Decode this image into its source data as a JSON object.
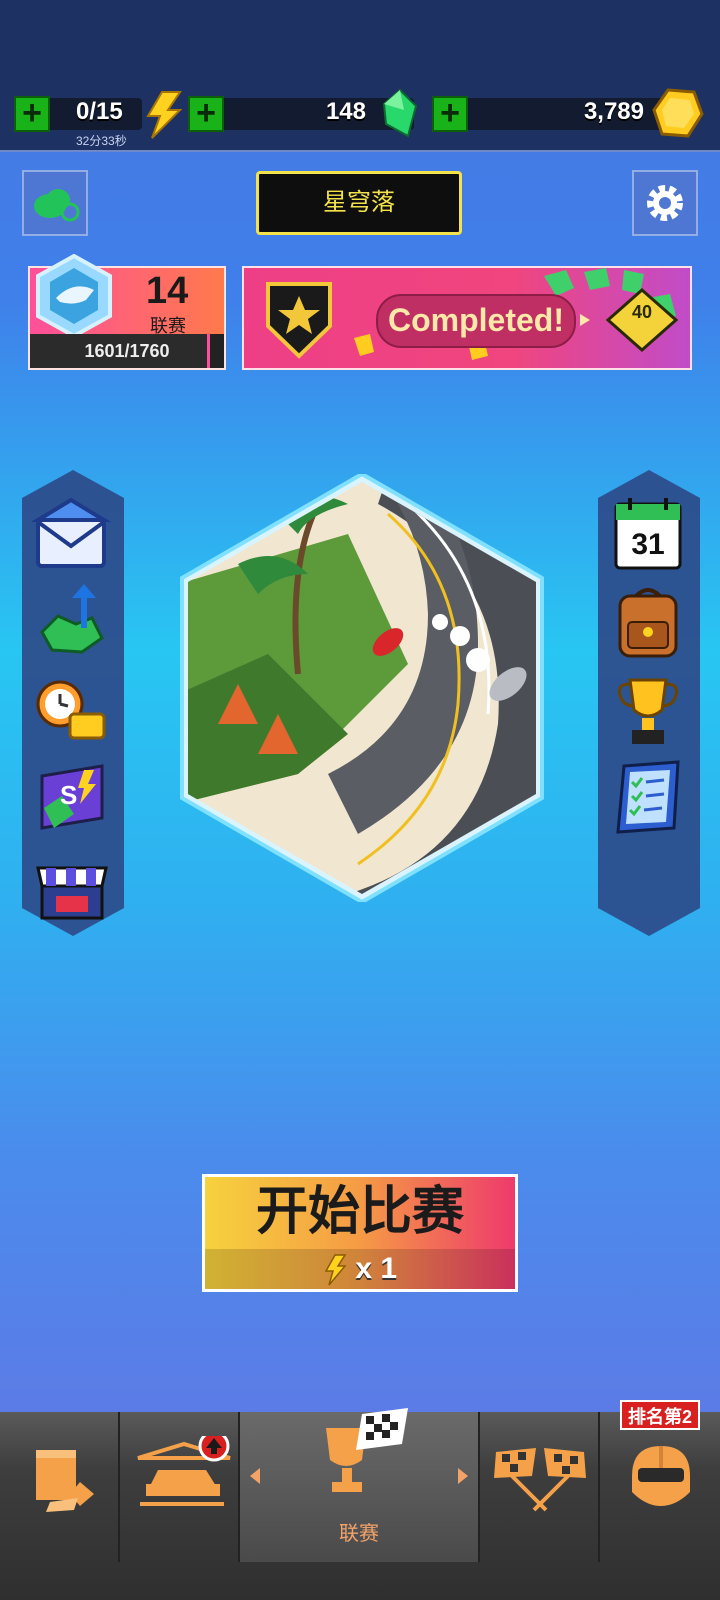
{
  "resources": {
    "energy": {
      "value": "0/15",
      "timer": "32分33秒"
    },
    "gems": {
      "value": "148"
    },
    "coins": {
      "value": "3,789"
    }
  },
  "header": {
    "player_name": "星穹落"
  },
  "league": {
    "number": "14",
    "label": "联赛",
    "progress": "1601/1760",
    "progress_fraction": 0.91
  },
  "quest": {
    "status": "Completed!",
    "reward": "40"
  },
  "left_menu": [
    "mail-icon",
    "gem-upgrade-icon",
    "timed-coins-icon",
    "season-pass-icon",
    "shop-icon"
  ],
  "right_menu": {
    "calendar_day": "31",
    "items": [
      "calendar-icon",
      "backpack-icon",
      "trophy-icon",
      "checklist-icon"
    ]
  },
  "start": {
    "title": "开始比赛",
    "cost": "x 1"
  },
  "nav": {
    "active_label": "联赛",
    "rank_badge": "排名第2"
  },
  "colors": {
    "accent_green": "#19b219",
    "gold": "#f3e24a",
    "nav_text": "#f2a36a",
    "badge_red": "#d82020"
  }
}
